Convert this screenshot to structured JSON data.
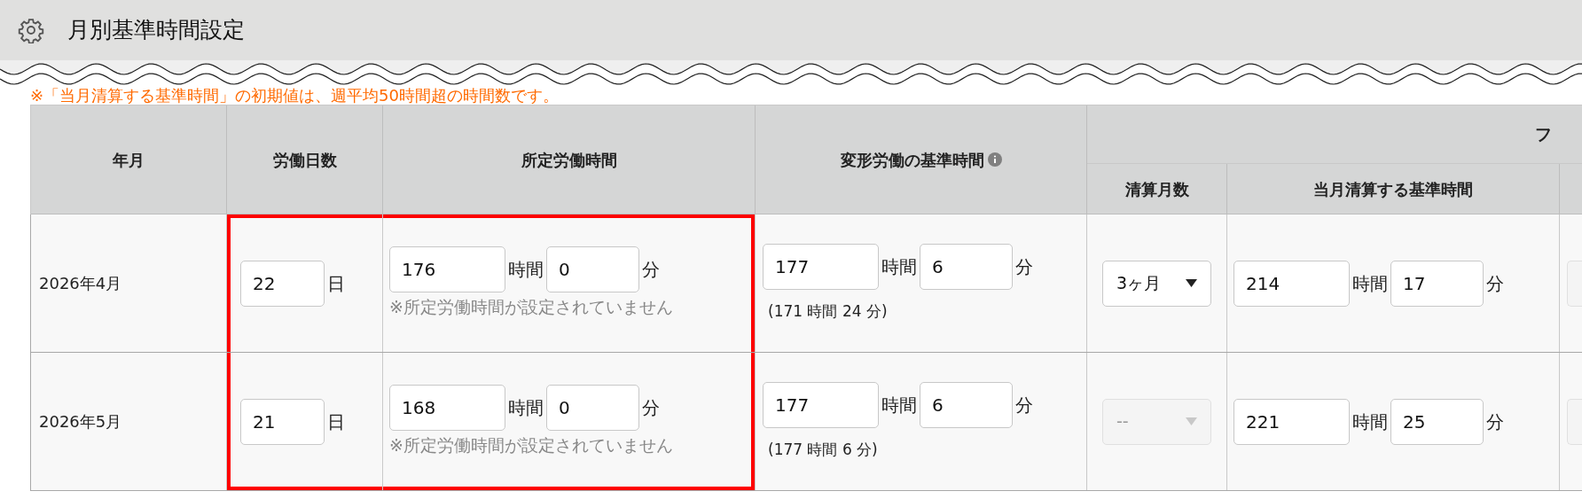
{
  "title": "月別基準時間設定",
  "notice": "※「当月清算する基準時間」の初期値は、週平均50時間超の時間数です。",
  "columns": [
    {
      "label": "年月",
      "highlighted": false
    },
    {
      "label": "労働日数",
      "highlighted": true
    },
    {
      "label": "所定労働時間",
      "highlighted": true
    },
    {
      "label": "変形労働の基準時間",
      "highlighted": false,
      "info": true
    }
  ],
  "group": {
    "label": "フ",
    "columns": [
      {
        "label": "清算月数"
      },
      {
        "label": "当月清算する基準時間"
      }
    ]
  },
  "rows": [
    {
      "month": "2026年4月",
      "days": {
        "value": "22",
        "unit": "日"
      },
      "scheduled": {
        "hours": "176",
        "hours_unit": "時間",
        "minutes": "0",
        "minutes_unit": "分",
        "warning": "※所定労働時間が設定されていません"
      },
      "variable": {
        "hours": "177",
        "hours_unit": "時間",
        "minutes": "6",
        "minutes_unit": "分",
        "note": "(171 時間 24 分)"
      },
      "settlement_months": {
        "value": "3ヶ月",
        "disabled": false
      },
      "settlement": {
        "hours": "214",
        "hours_unit": "時間",
        "minutes": "17",
        "minutes_unit": "分"
      }
    },
    {
      "month": "2026年5月",
      "days": {
        "value": "21",
        "unit": "日"
      },
      "scheduled": {
        "hours": "168",
        "hours_unit": "時間",
        "minutes": "0",
        "minutes_unit": "分",
        "warning": "※所定労働時間が設定されていません"
      },
      "variable": {
        "hours": "177",
        "hours_unit": "時間",
        "minutes": "6",
        "minutes_unit": "分",
        "note": "(177 時間 6 分)"
      },
      "settlement_months": {
        "value": "--",
        "disabled": true
      },
      "settlement": {
        "hours": "221",
        "hours_unit": "時間",
        "minutes": "25",
        "minutes_unit": "分"
      }
    }
  ]
}
